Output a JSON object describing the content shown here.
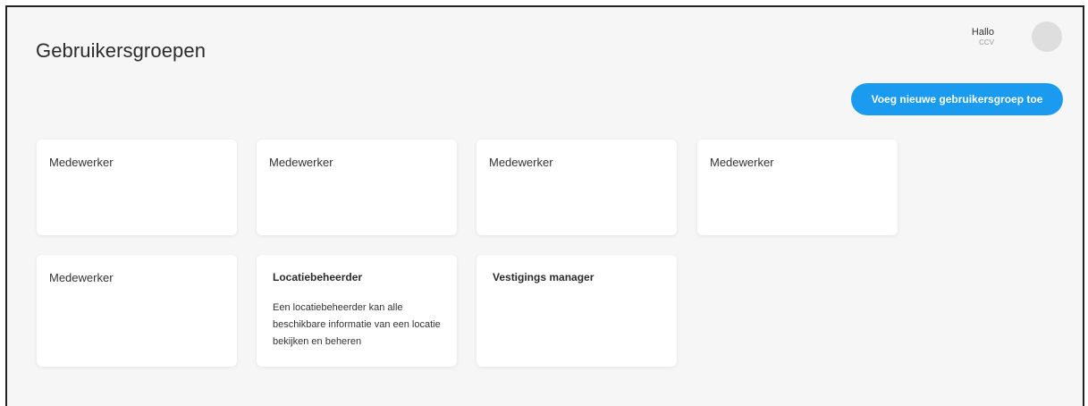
{
  "page": {
    "title": "Gebruikersgroepen"
  },
  "user": {
    "greeting": "Hallo",
    "name": "CCV"
  },
  "actions": {
    "add_group": "Voeg nieuwe gebruikersgroep toe"
  },
  "groups": [
    {
      "name": "Medewerker",
      "description": ""
    },
    {
      "name": "Medewerker",
      "description": ""
    },
    {
      "name": "Medewerker",
      "description": ""
    },
    {
      "name": "Medewerker",
      "description": ""
    },
    {
      "name": "Medewerker",
      "description": ""
    },
    {
      "name": "Locatiebeheerder",
      "description": "Een locatiebeheerder kan alle beschikbare informatie van een locatie bekijken en beheren"
    },
    {
      "name": "Vestigings manager",
      "description": ""
    }
  ],
  "colors": {
    "accent": "#1a9bf0",
    "background": "#f6f6f7",
    "card": "#ffffff"
  }
}
